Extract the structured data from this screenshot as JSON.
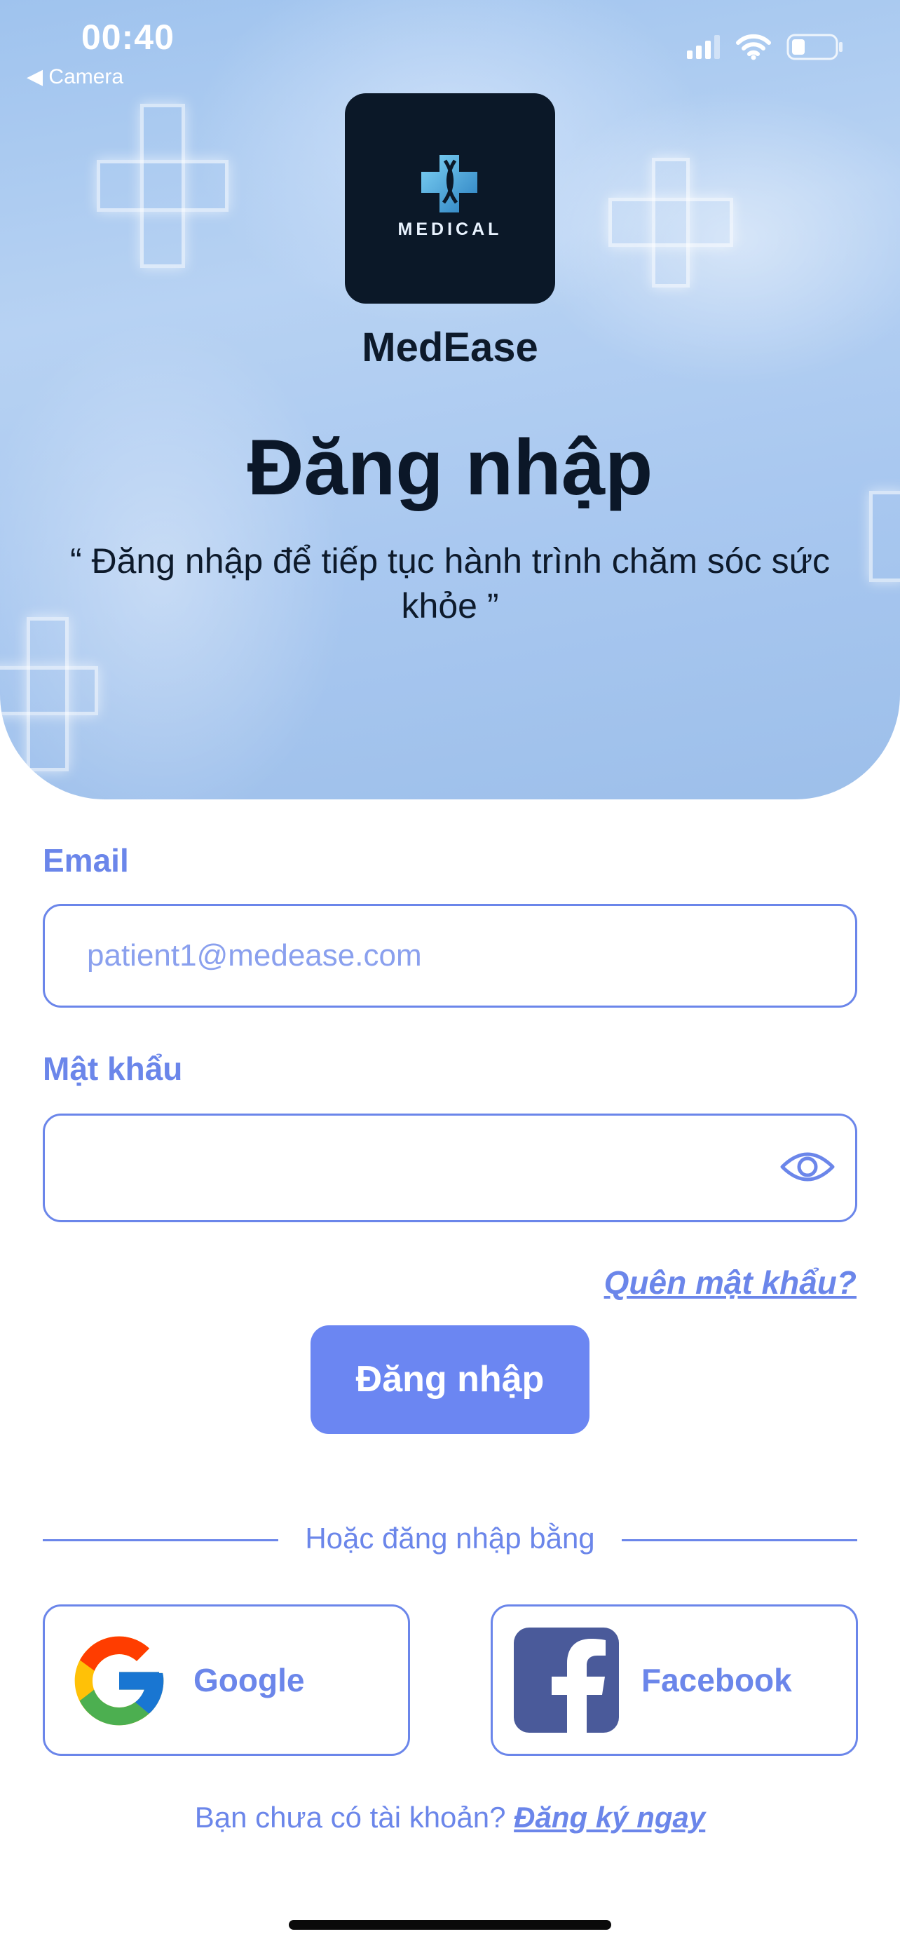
{
  "status_bar": {
    "time": "00:40",
    "back_label": "◀ Camera",
    "back_app": "Camera"
  },
  "app": {
    "logo_text": "MEDICAL",
    "name": "MedEase"
  },
  "hero": {
    "title": "Đăng nhập",
    "subtitle": "“ Đăng nhập để tiếp tục hành trình chăm sóc sức khỏe ”"
  },
  "form": {
    "email_label": "Email",
    "email_placeholder": "patient1@medease.com",
    "email_value": "",
    "password_label": "Mật khẩu",
    "password_value": "",
    "forgot_password": "Quên mật khẩu?",
    "login_button": "Đăng nhập"
  },
  "social": {
    "divider_text": "Hoặc đăng nhập bằng",
    "google_label": "Google",
    "facebook_label": "Facebook"
  },
  "footer": {
    "no_account": "Bạn chưa có tài khoản?",
    "signup_link": "Đăng ký ngay"
  },
  "colors": {
    "accent": "#6b86ea",
    "button": "#6b86f2",
    "logo_bg": "#0b1828",
    "title_text": "#0b1728",
    "facebook": "#4a5a9a"
  },
  "icons": {
    "eye": "eye-icon",
    "google": "google-logo-icon",
    "facebook": "facebook-logo-icon",
    "signal": "cellular-signal-icon",
    "wifi": "wifi-icon",
    "battery": "battery-icon",
    "medical_cross": "medical-cross-icon"
  }
}
